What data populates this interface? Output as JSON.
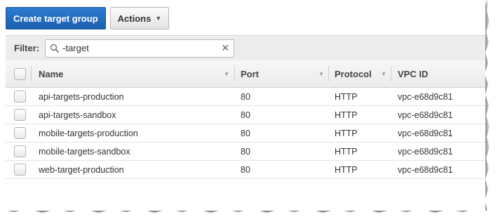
{
  "toolbar": {
    "create_label": "Create target group",
    "actions_label": "Actions"
  },
  "filter": {
    "label": "Filter:",
    "value": "-target"
  },
  "table": {
    "columns": {
      "name": "Name",
      "port": "Port",
      "protocol": "Protocol",
      "vpc": "VPC ID"
    },
    "rows": [
      {
        "name": "api-targets-production",
        "port": "80",
        "protocol": "HTTP",
        "vpc": "vpc-e68d9c81"
      },
      {
        "name": "api-targets-sandbox",
        "port": "80",
        "protocol": "HTTP",
        "vpc": "vpc-e68d9c81"
      },
      {
        "name": "mobile-targets-production",
        "port": "80",
        "protocol": "HTTP",
        "vpc": "vpc-e68d9c81"
      },
      {
        "name": "mobile-targets-sandbox",
        "port": "80",
        "protocol": "HTTP",
        "vpc": "vpc-e68d9c81"
      },
      {
        "name": "web-target-production",
        "port": "80",
        "protocol": "HTTP",
        "vpc": "vpc-e68d9c81"
      }
    ]
  },
  "icons": {
    "search": "search-icon",
    "clear": "close-icon",
    "actions_chevron": "chevron-down-icon",
    "sort": "sort-icon"
  },
  "colors": {
    "primary_button": "#1f66b8",
    "header_bg": "#efefef",
    "filter_bg": "#ededed"
  }
}
